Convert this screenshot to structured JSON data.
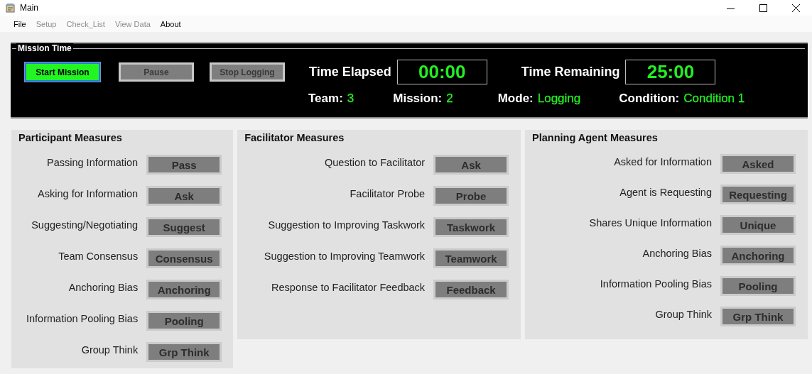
{
  "window": {
    "title": "Main"
  },
  "menu": [
    {
      "label": "File",
      "disabled": false
    },
    {
      "label": "Setup",
      "disabled": true
    },
    {
      "label": "Check_List",
      "disabled": true
    },
    {
      "label": "View Data",
      "disabled": true
    },
    {
      "label": "About",
      "disabled": false
    }
  ],
  "mission_time": {
    "title": "Mission Time",
    "buttons": [
      {
        "label": "Start Mission",
        "disabled": false
      },
      {
        "label": "Pause",
        "disabled": true
      },
      {
        "label": "Stop Logging",
        "disabled": true
      }
    ],
    "time_elapsed": {
      "label": "Time Elapsed",
      "value": "00:00"
    },
    "time_remaining": {
      "label": "Time Remaining",
      "value": "25:00"
    },
    "info": [
      {
        "label": "Team:",
        "value": "3"
      },
      {
        "label": "Mission:",
        "value": "2"
      },
      {
        "label": "Mode:",
        "value": "Logging"
      },
      {
        "label": "Condition:",
        "value": "Condition 1"
      }
    ]
  },
  "panels": [
    {
      "title": "Participant Measures",
      "rows": [
        {
          "label": "Passing Information",
          "button": "Pass"
        },
        {
          "label": "Asking for Information",
          "button": "Ask"
        },
        {
          "label": "Suggesting/Negotiating",
          "button": "Suggest"
        },
        {
          "label": "Team Consensus",
          "button": "Consensus"
        },
        {
          "label": "Anchoring Bias",
          "button": "Anchoring"
        },
        {
          "label": "Information Pooling Bias",
          "button": "Pooling"
        },
        {
          "label": "Group Think",
          "button": "Grp Think"
        }
      ]
    },
    {
      "title": "Facilitator Measures",
      "rows": [
        {
          "label": "Question to Facilitator",
          "button": "Ask"
        },
        {
          "label": "Facilitator Probe",
          "button": "Probe"
        },
        {
          "label": "Suggestion to Improving Taskwork",
          "button": "Taskwork"
        },
        {
          "label": "Suggestion to Improving Teamwork",
          "button": "Teamwork"
        },
        {
          "label": "Response to Facilitator Feedback",
          "button": "Feedback"
        }
      ]
    },
    {
      "title": "Planning Agent Measures",
      "rows": [
        {
          "label": "Asked for Information",
          "button": "Asked"
        },
        {
          "label": "Agent is Requesting",
          "button": "Requesting"
        },
        {
          "label": "Shares Unique Information",
          "button": "Unique"
        },
        {
          "label": "Anchoring Bias",
          "button": "Anchoring"
        },
        {
          "label": "Information Pooling Bias",
          "button": "Pooling"
        },
        {
          "label": "Group Think",
          "button": "Grp Think"
        }
      ]
    }
  ]
}
